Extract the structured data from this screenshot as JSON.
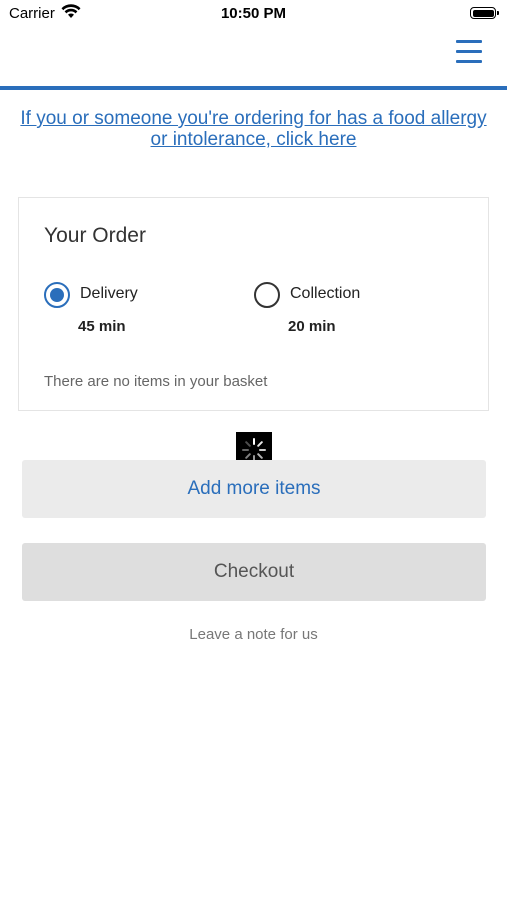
{
  "status_bar": {
    "carrier": "Carrier",
    "time": "10:50 PM",
    "battery_level": 1.0,
    "icons": [
      "wifi-icon",
      "battery-icon"
    ]
  },
  "header": {
    "menu_icon": "hamburger-menu-icon",
    "accent_color": "#2a6ebb"
  },
  "allergy_notice": {
    "link_text": "If you or someone you're ordering for has a food allergy or intolerance, click here"
  },
  "order": {
    "title": "Your Order",
    "options": [
      {
        "label": "Delivery",
        "time": "45 min",
        "selected": true
      },
      {
        "label": "Collection",
        "time": "20 min",
        "selected": false
      }
    ],
    "empty_message": "There are no items in your basket"
  },
  "loading_indicator": "spinner-icon",
  "actions": {
    "add_more_label": "Add more items",
    "checkout_label": "Checkout",
    "leave_note_label": "Leave a note for us"
  }
}
